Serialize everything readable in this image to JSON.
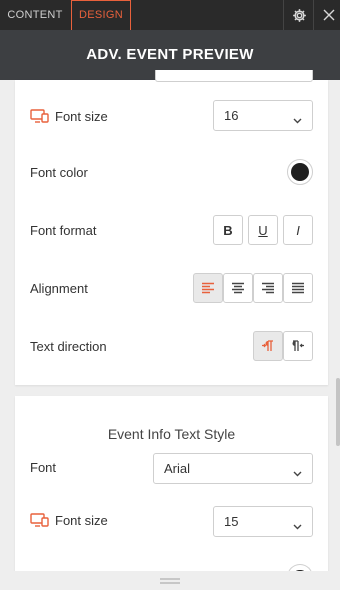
{
  "tabs": {
    "content": "CONTENT",
    "design": "DESIGN"
  },
  "header": {
    "title": "ADV. EVENT PREVIEW"
  },
  "card1": {
    "font_size_label": "Font size",
    "font_size_value": "16",
    "font_color_label": "Font color",
    "font_color_value": "#1f1f1f",
    "font_format_label": "Font format",
    "format_buttons": {
      "bold": "B",
      "underline": "U",
      "italic": "I"
    },
    "alignment_label": "Alignment",
    "text_direction_label": "Text direction"
  },
  "card2": {
    "title": "Event Info Text Style",
    "font_label": "Font",
    "font_value": "Arial",
    "font_size_label": "Font size",
    "font_size_value": "15"
  },
  "colors": {
    "accent": "#e8613c",
    "header_bg": "#3d3f42",
    "tabbar_bg": "#2a2a2a"
  },
  "icons": [
    "gear-icon",
    "close-icon",
    "monitor-icon",
    "chevron-down-icon",
    "align-left-icon",
    "align-center-icon",
    "align-right-icon",
    "align-justify-icon",
    "ltr-icon",
    "rtl-icon",
    "drag-handle-icon"
  ]
}
